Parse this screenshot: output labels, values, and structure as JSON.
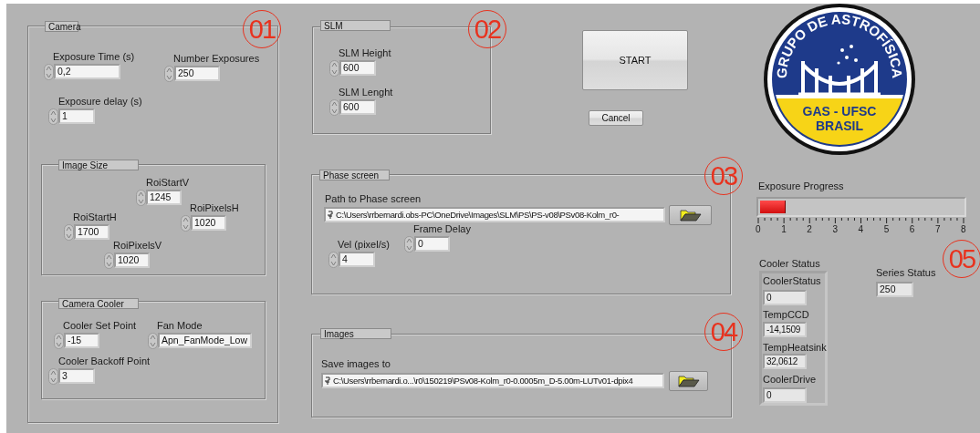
{
  "camera": {
    "title": "Camera",
    "controls": [
      {
        "label": "Exposure Time (s)",
        "value": "0,2"
      },
      {
        "label": "Number Exposures",
        "value": "250"
      },
      {
        "label": "Exposure delay (s)",
        "value": "1"
      }
    ],
    "image_size": {
      "title": "Image Size",
      "controls": [
        {
          "label": "RoiStartV",
          "value": "1245"
        },
        {
          "label": "RoiPixelsH",
          "value": "1020"
        },
        {
          "label": "RoiStartH",
          "value": "1700"
        },
        {
          "label": "RoiPixelsV",
          "value": "1020"
        }
      ]
    },
    "cooler": {
      "title": "Camera Cooler",
      "controls": [
        {
          "label": "Cooler Set Point",
          "value": "-15"
        },
        {
          "label": "Fan Mode",
          "value": "Apn_FanMode_Low"
        },
        {
          "label": "Cooler Backoff Point",
          "value": "3"
        }
      ]
    }
  },
  "slm": {
    "title": "SLM",
    "controls": [
      {
        "label": "SLM Height",
        "value": "600"
      },
      {
        "label": "SLM Lenght",
        "value": "600"
      }
    ]
  },
  "start_button": "START",
  "cancel_button": "Cancel",
  "logo": {
    "arc_text": "GRUPO DE ASTROFÍSICA",
    "line_1": "GAS - UFSC",
    "line_2": "BRASIL"
  },
  "phase_screen": {
    "title": "Phase screen",
    "path": {
      "label": "Path to Phase screen",
      "value": "C:\\Users\\rrbernardi.obs-PC\\OneDrive\\Images\\SLM\\PS\\PS-v08\\PSv08-Kolm_r0-"
    },
    "controls": [
      {
        "label": "Frame Delay",
        "value": "0"
      },
      {
        "label": "Vel (pixel/s)",
        "value": "4"
      }
    ]
  },
  "images": {
    "title": "Images",
    "path": {
      "label": "Save images to",
      "value": "C:\\Users\\rrbernardi.o...\\r0\\150219\\PSv08-Kolm_r0-0.0005m_D-5.00m-LUTv01-dpix4"
    }
  },
  "exposure_progress": {
    "label": "Exposure Progress",
    "level": 0.12,
    "scale": [
      "0",
      "1",
      "2",
      "3",
      "4",
      "5",
      "6",
      "7",
      "8"
    ]
  },
  "cooler_status": {
    "label": "Cooler Status",
    "items": [
      {
        "label": "CoolerStatus",
        "value": "0"
      },
      {
        "label": "TempCCD",
        "value": "-14,1509"
      },
      {
        "label": "TempHeatsink",
        "value": "32,0612"
      },
      {
        "label": "CoolerDrive",
        "value": "0"
      }
    ]
  },
  "series_status": {
    "label": "Series Status",
    "value": "250"
  },
  "callouts": [
    "01",
    "02",
    "03",
    "04",
    "05"
  ]
}
